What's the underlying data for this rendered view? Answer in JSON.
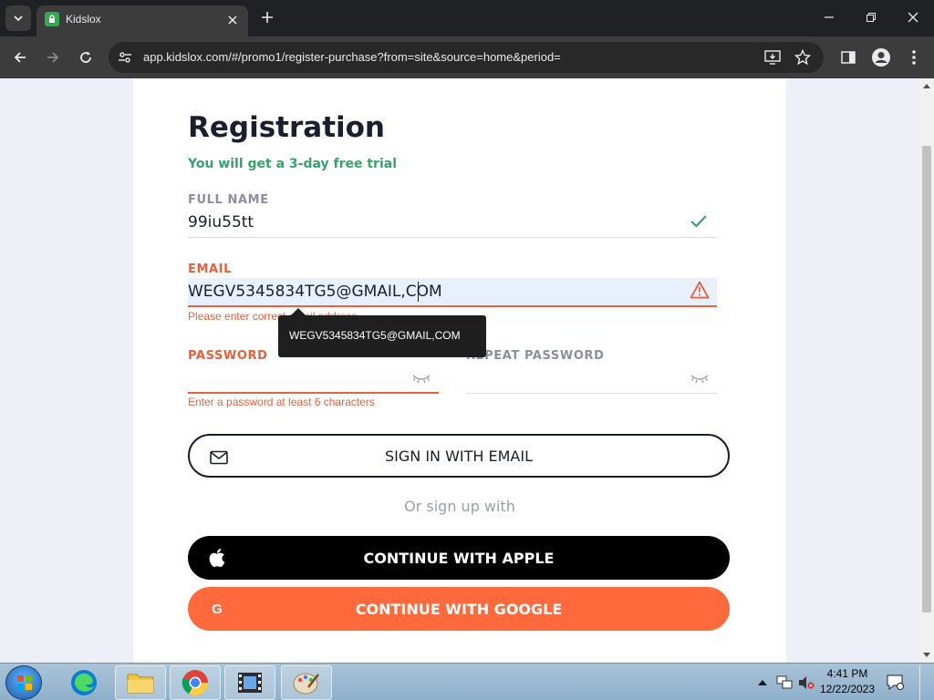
{
  "browser": {
    "tab_title": "Kidslox",
    "url": "app.kidslox.com/#/promo1/register-purchase?from=site&source=home&period="
  },
  "page": {
    "title": "Registration",
    "subtitle": "You will get a 3-day free trial",
    "full_name": {
      "label": "FULL NAME",
      "value": "99iu55tt"
    },
    "email": {
      "label": "EMAIL",
      "value": "WEGV5345834TG5@GMAIL,COM",
      "error": "Please enter correct email address",
      "tooltip": "WEGV5345834TG5@GMAIL,COM"
    },
    "password": {
      "label": "PASSWORD",
      "error": "Enter a password at least 6 characters"
    },
    "repeat_password": {
      "label": "REPEAT PASSWORD"
    },
    "sign_in_email": "SIGN IN WITH EMAIL",
    "or_sign_up": "Or sign up with",
    "continue_apple": "CONTINUE WITH APPLE",
    "continue_google": "CONTINUE WITH GOOGLE"
  },
  "taskbar": {
    "time": "4:41 PM",
    "date": "12/22/2023"
  },
  "colors": {
    "accent_green": "#39a16f",
    "error_orange": "#e8603c",
    "google_button": "#ff6a3d",
    "apple_button": "#000000"
  }
}
